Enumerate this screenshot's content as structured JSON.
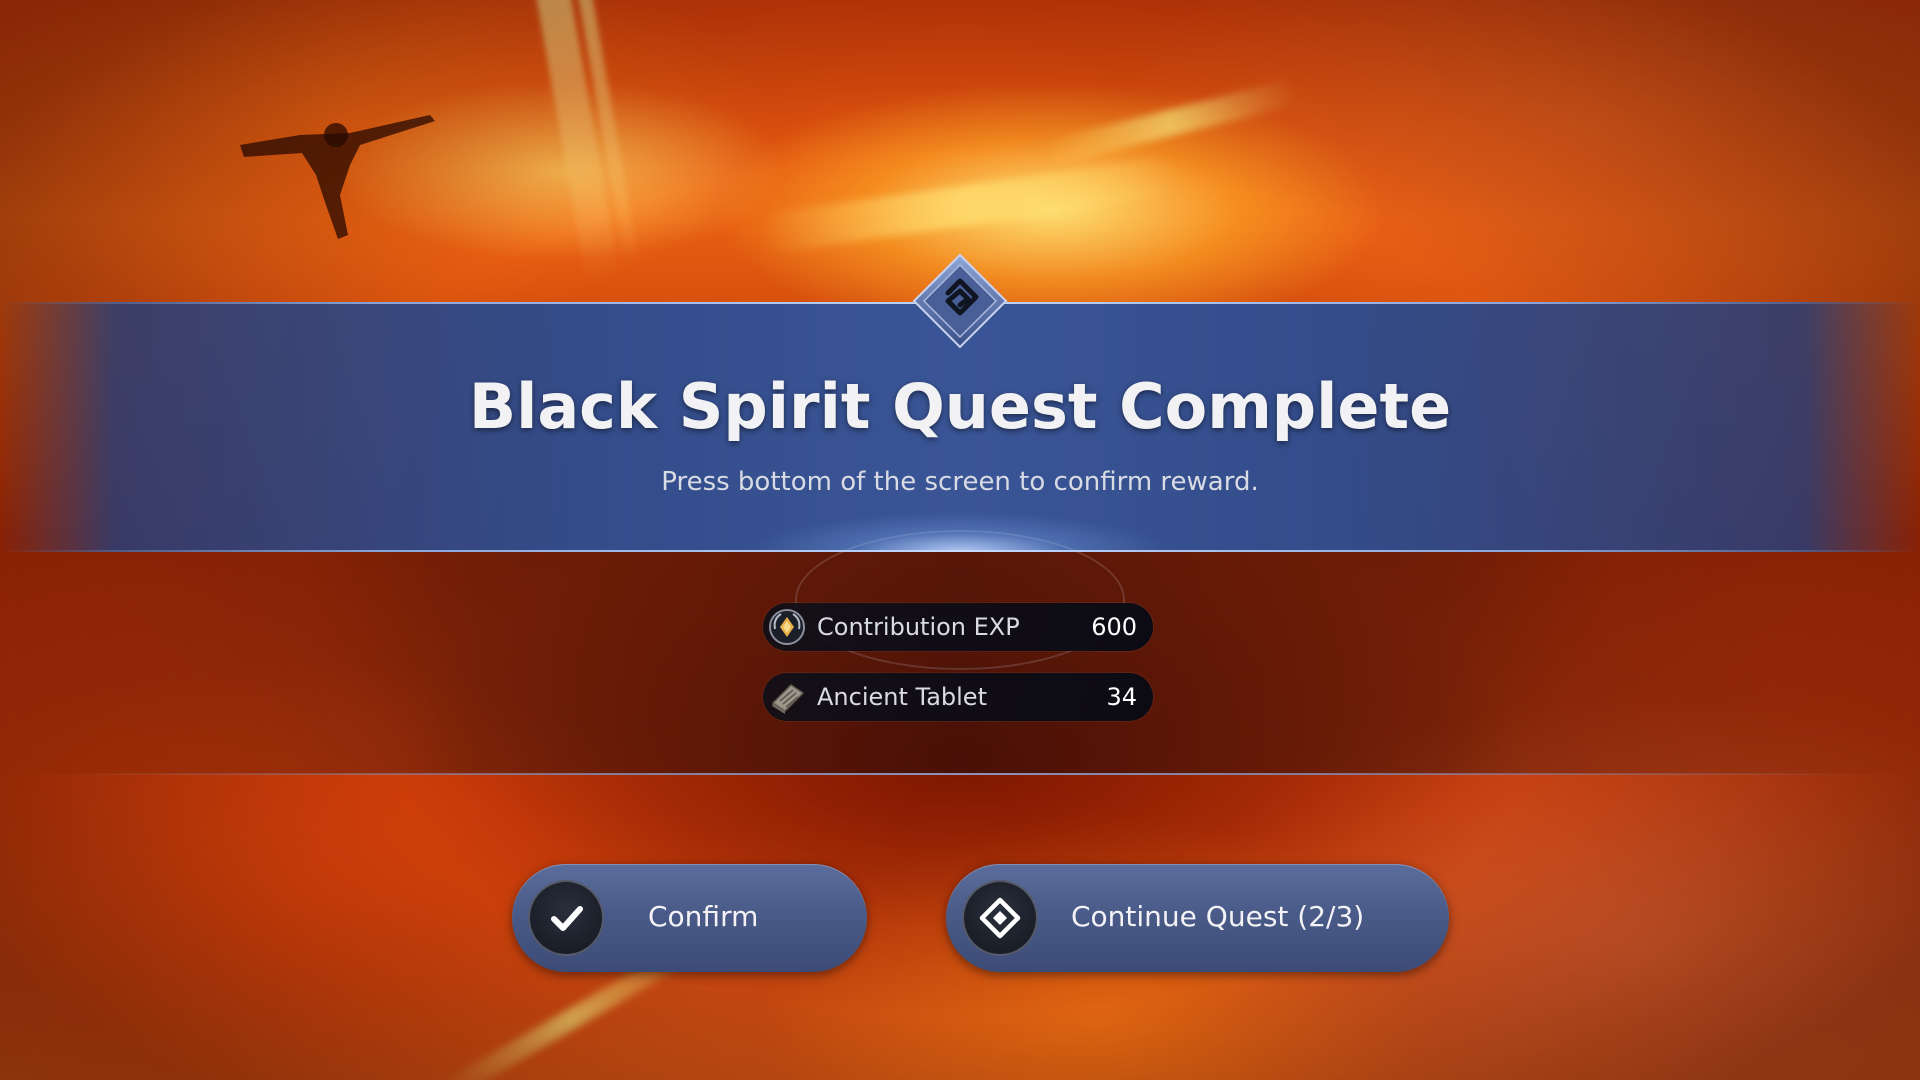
{
  "quest_complete": {
    "title": "Black Spirit Quest Complete",
    "subtitle": "Press bottom of the screen to confirm reward.",
    "emblem_icon": "black-spirit-emblem-icon"
  },
  "rewards": [
    {
      "label": "Contribution EXP",
      "value": "600",
      "icon": "contribution-exp-icon"
    },
    {
      "label": "Ancient Tablet",
      "value": "34",
      "icon": "ancient-tablet-icon"
    }
  ],
  "buttons": {
    "confirm_label": "Confirm",
    "confirm_icon": "checkmark-icon",
    "continue_label": "Continue Quest (2/3)",
    "continue_icon": "diamond-arrow-icon"
  },
  "colors": {
    "banner": "#3a5596",
    "button": "#4a5b89",
    "accent_gold": "#e8b04a"
  }
}
